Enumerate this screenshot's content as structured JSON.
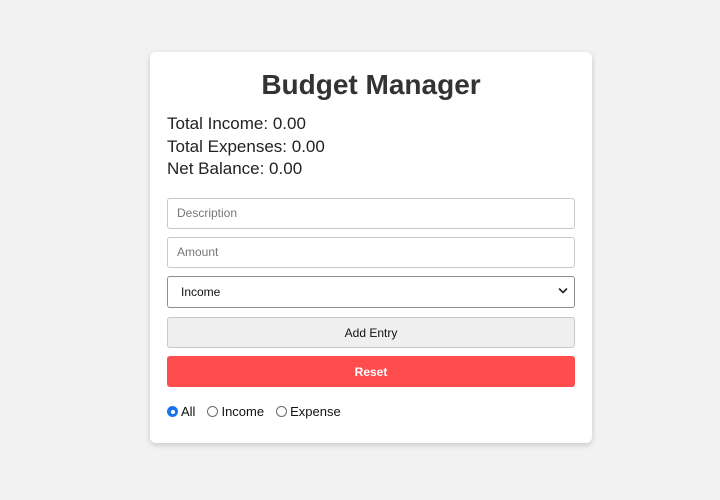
{
  "app": {
    "title": "Budget Manager"
  },
  "totals": {
    "income": "Total Income: 0.00",
    "expenses": "Total Expenses: 0.00",
    "net": "Net Balance: 0.00"
  },
  "form": {
    "description_placeholder": "Description",
    "description_value": "",
    "amount_placeholder": "Amount",
    "amount_value": "",
    "type_selected": "Income",
    "add_label": "Add Entry",
    "reset_label": "Reset"
  },
  "filters": [
    {
      "label": "All",
      "checked": true
    },
    {
      "label": "Income",
      "checked": false
    },
    {
      "label": "Expense",
      "checked": false
    }
  ],
  "colors": {
    "reset_bg": "#ff4d4d",
    "radio_accent": "#1a73e8",
    "page_bg": "#f2f2f2",
    "card_bg": "#ffffff"
  }
}
